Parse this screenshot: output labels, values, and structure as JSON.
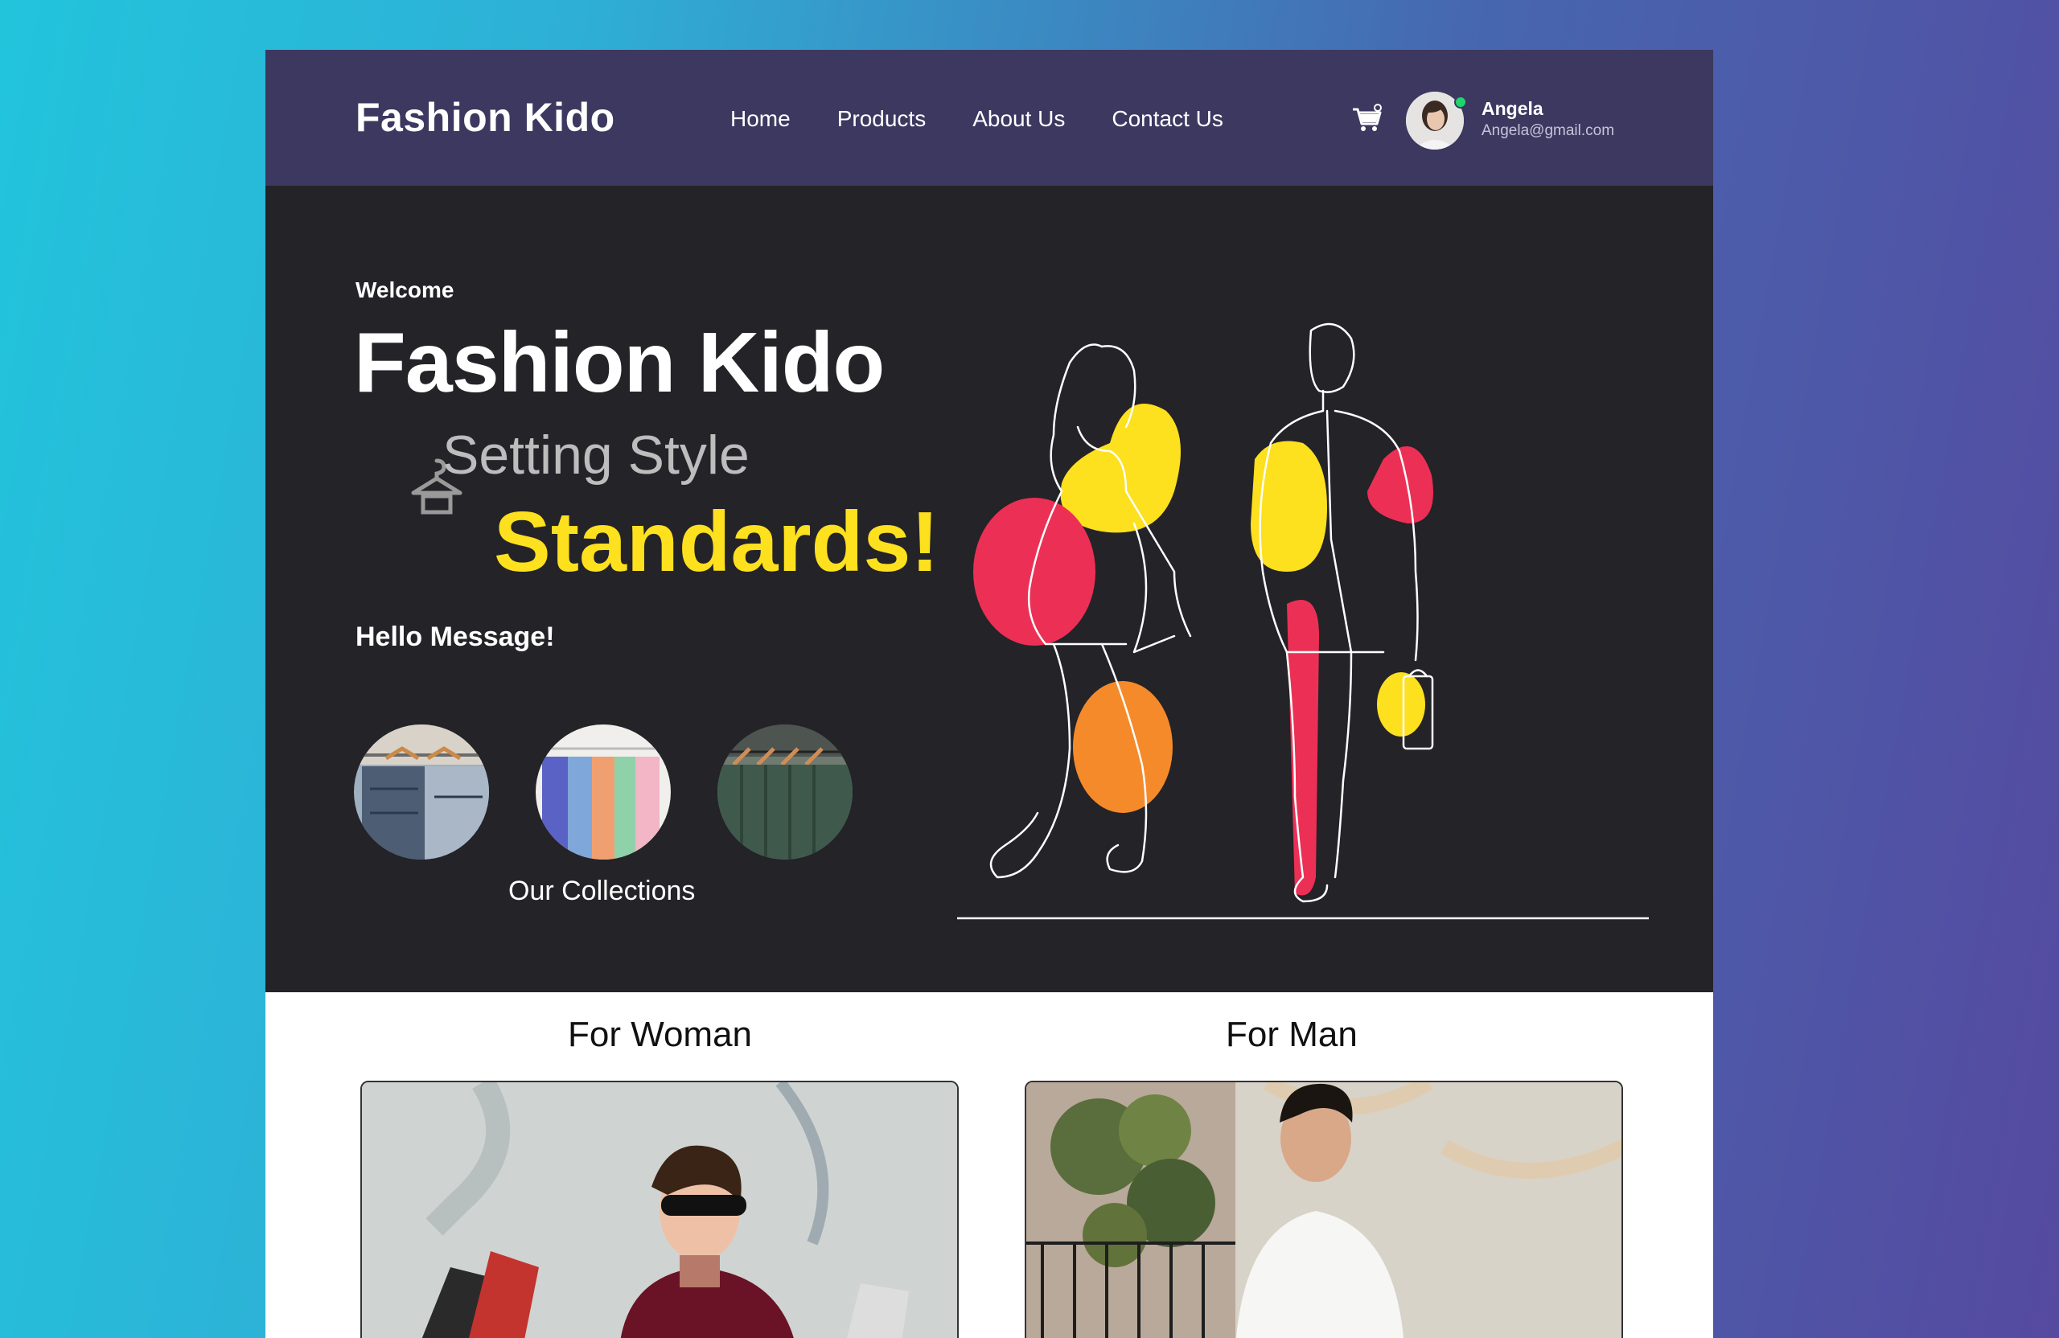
{
  "header": {
    "brand": "Fashion Kido",
    "nav": [
      "Home",
      "Products",
      "About Us",
      "Contact Us"
    ],
    "user": {
      "name": "Angela",
      "email": "Angela@gmail.com",
      "status": "online"
    }
  },
  "hero": {
    "welcome": "Welcome",
    "title": "Fashion Kido",
    "tagline_line1": "Setting Style",
    "tagline_line2": "Standards!",
    "hello": "Hello Message!",
    "collections_label": "Our Collections"
  },
  "sections": {
    "woman": "For Woman",
    "man": "For Man"
  },
  "colors": {
    "header_bg": "#3c3860",
    "hero_bg": "#242328",
    "accent_yellow": "#fde01e",
    "accent_red": "#ec3055",
    "accent_orange": "#f58a2b",
    "online": "#1fd66b"
  },
  "icons": [
    "cart-icon",
    "hanger-icon"
  ]
}
